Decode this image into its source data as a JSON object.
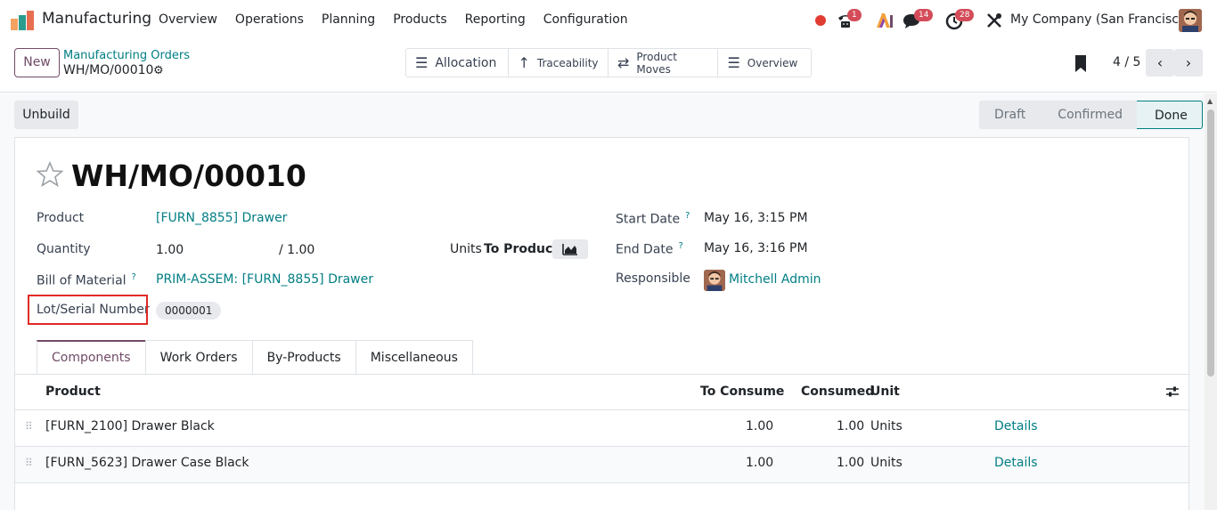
{
  "app": {
    "name": "Manufacturing"
  },
  "menu": [
    "Overview",
    "Operations",
    "Planning",
    "Products",
    "Reporting",
    "Configuration"
  ],
  "systray": {
    "activity_badge": "1",
    "messages_badge": "14",
    "clock_badge": "28",
    "company": "My Company (San Francisco)"
  },
  "control_panel": {
    "new_label": "New",
    "breadcrumb_parent": "Manufacturing Orders",
    "breadcrumb_current": "WH/MO/00010",
    "smart_buttons": {
      "allocation": "Allocation",
      "traceability": "Traceability",
      "product_moves": "Product Moves",
      "overview": "Overview"
    },
    "pager": "4 / 5"
  },
  "actions": {
    "unbuild": "Unbuild"
  },
  "statusbar": {
    "stages": [
      "Draft",
      "Confirmed",
      "Done"
    ],
    "current": "Done"
  },
  "form": {
    "title": "WH/MO/00010",
    "product_label": "Product",
    "product_value": "[FURN_8855] Drawer",
    "quantity_label": "Quantity",
    "quantity_value": "1.00",
    "quantity_total": "/ 1.00",
    "units_label": "Units",
    "to_produce_label": "To Produce",
    "bom_label": "Bill of Material",
    "bom_help": "?",
    "bom_value": "PRIM-ASSEM: [FURN_8855] Drawer",
    "lot_label": "Lot/Serial Number",
    "lot_value": "0000001",
    "start_label": "Start Date",
    "start_help": "?",
    "start_value": "May 16, 3:15 PM",
    "end_label": "End Date",
    "end_help": "?",
    "end_value": "May 16, 3:16 PM",
    "responsible_label": "Responsible",
    "responsible_value": "Mitchell Admin"
  },
  "tabs": [
    "Components",
    "Work Orders",
    "By-Products",
    "Miscellaneous"
  ],
  "table": {
    "headers": {
      "product": "Product",
      "to_consume": "To Consume",
      "consumed": "Consumed",
      "unit": "Unit"
    },
    "rows": [
      {
        "product": "[FURN_2100] Drawer Black",
        "to_consume": "1.00",
        "consumed": "1.00",
        "unit": "Units",
        "action": "Details"
      },
      {
        "product": "[FURN_5623] Drawer Case Black",
        "to_consume": "1.00",
        "consumed": "1.00",
        "unit": "Units",
        "action": "Details"
      }
    ]
  },
  "colors": {
    "brand": "#714b67",
    "link": "#017e84",
    "highlight_box": "#e02b27",
    "badge": "#d44c59"
  }
}
